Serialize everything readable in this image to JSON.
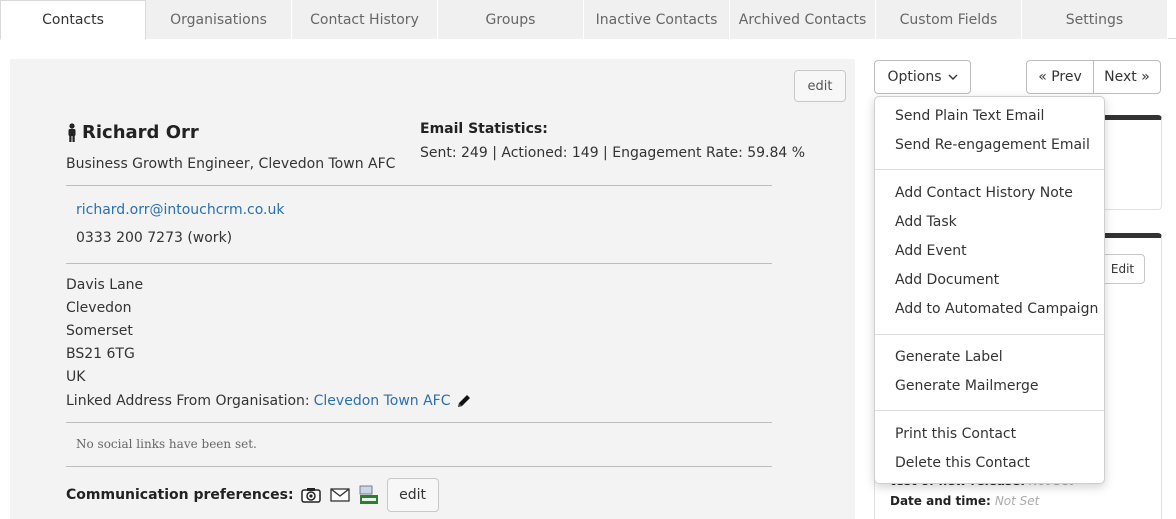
{
  "tabs": [
    "Contacts",
    "Organisations",
    "Contact History",
    "Groups",
    "Inactive Contacts",
    "Archived Contacts",
    "Custom Fields",
    "Settings"
  ],
  "contact": {
    "edit_label": "edit",
    "name": "Richard Orr",
    "job_title": "Business Growth Engineer, Clevedon Town AFC",
    "email_stats_title": "Email Statistics:",
    "email_stats": "Sent: 249 | Actioned: 149 | Engagement Rate: 59.84 %",
    "email": "richard.orr@intouchcrm.co.uk",
    "phone": "0333 200 7273 (work)",
    "address": [
      "Davis Lane",
      "Clevedon",
      "Somerset",
      "BS21 6TG",
      "UK"
    ],
    "linked_address_label": "Linked Address From Organisation:",
    "linked_org": "Clevedon Town AFC",
    "social_note": "No social links have been set.",
    "comm_pref_label": "Communication preferences:",
    "comm_edit_label": "edit"
  },
  "toolbar": {
    "options_label": "Options",
    "prev_label": "« Prev",
    "next_label": "Next »"
  },
  "menu": {
    "group1": [
      "Send Plain Text Email",
      "Send Re-engagement Email"
    ],
    "group2": [
      "Add Contact History Note",
      "Add Task",
      "Add Event",
      "Add Document",
      "Add to Automated Campaign"
    ],
    "group3": [
      "Generate Label",
      "Generate Mailmerge"
    ],
    "group4": [
      "Print this Contact",
      "Delete this Contact"
    ]
  },
  "side_card": {
    "edit_label": "Edit",
    "fields": [
      {
        "label": "test of new release:",
        "value": "Not Set"
      },
      {
        "label": "Date and time:",
        "value": "Not Set"
      }
    ]
  },
  "icons": [
    "person-icon",
    "pencil-icon",
    "camera-icon",
    "mail-icon",
    "work-icon",
    "chevron-down-icon"
  ]
}
